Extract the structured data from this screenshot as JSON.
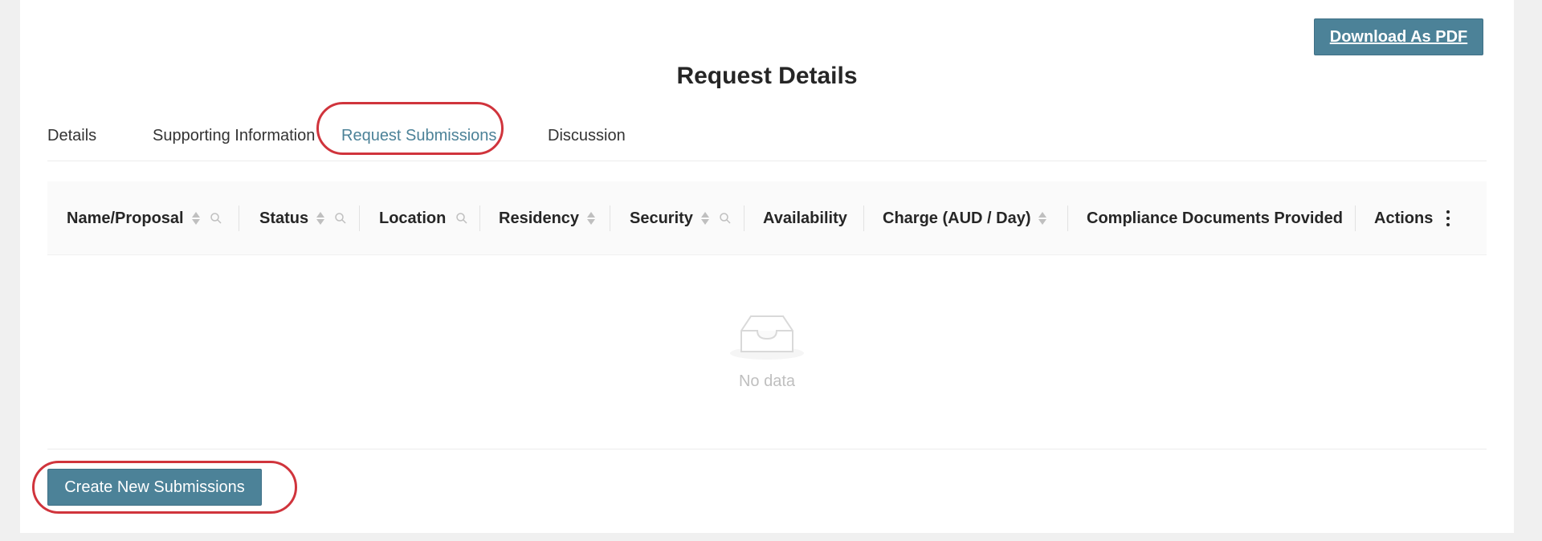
{
  "header": {
    "download_label": "Download As PDF",
    "title": "Request Details"
  },
  "tabs": [
    {
      "label": "Details",
      "active": false
    },
    {
      "label": "Supporting Information",
      "active": false
    },
    {
      "label": "Request Submissions",
      "active": true
    },
    {
      "label": "Discussion",
      "active": false
    }
  ],
  "table": {
    "columns": [
      {
        "label": "Name/Proposal",
        "sortable": true,
        "filterable": true
      },
      {
        "label": "Status",
        "sortable": true,
        "filterable": true
      },
      {
        "label": "Location",
        "sortable": false,
        "filterable": true
      },
      {
        "label": "Residency",
        "sortable": true,
        "filterable": false
      },
      {
        "label": "Security",
        "sortable": true,
        "filterable": true
      },
      {
        "label": "Availability",
        "sortable": false,
        "filterable": false
      },
      {
        "label": "Charge (AUD / Day)",
        "sortable": true,
        "filterable": false
      },
      {
        "label": "Compliance Documents Provided",
        "sortable": false,
        "filterable": false
      },
      {
        "label": "Actions",
        "sortable": false,
        "filterable": false
      }
    ],
    "empty_text": "No data"
  },
  "footer": {
    "create_label": "Create New Submissions"
  },
  "colors": {
    "accent": "#4c8298",
    "highlight_ring": "#d0343c"
  }
}
